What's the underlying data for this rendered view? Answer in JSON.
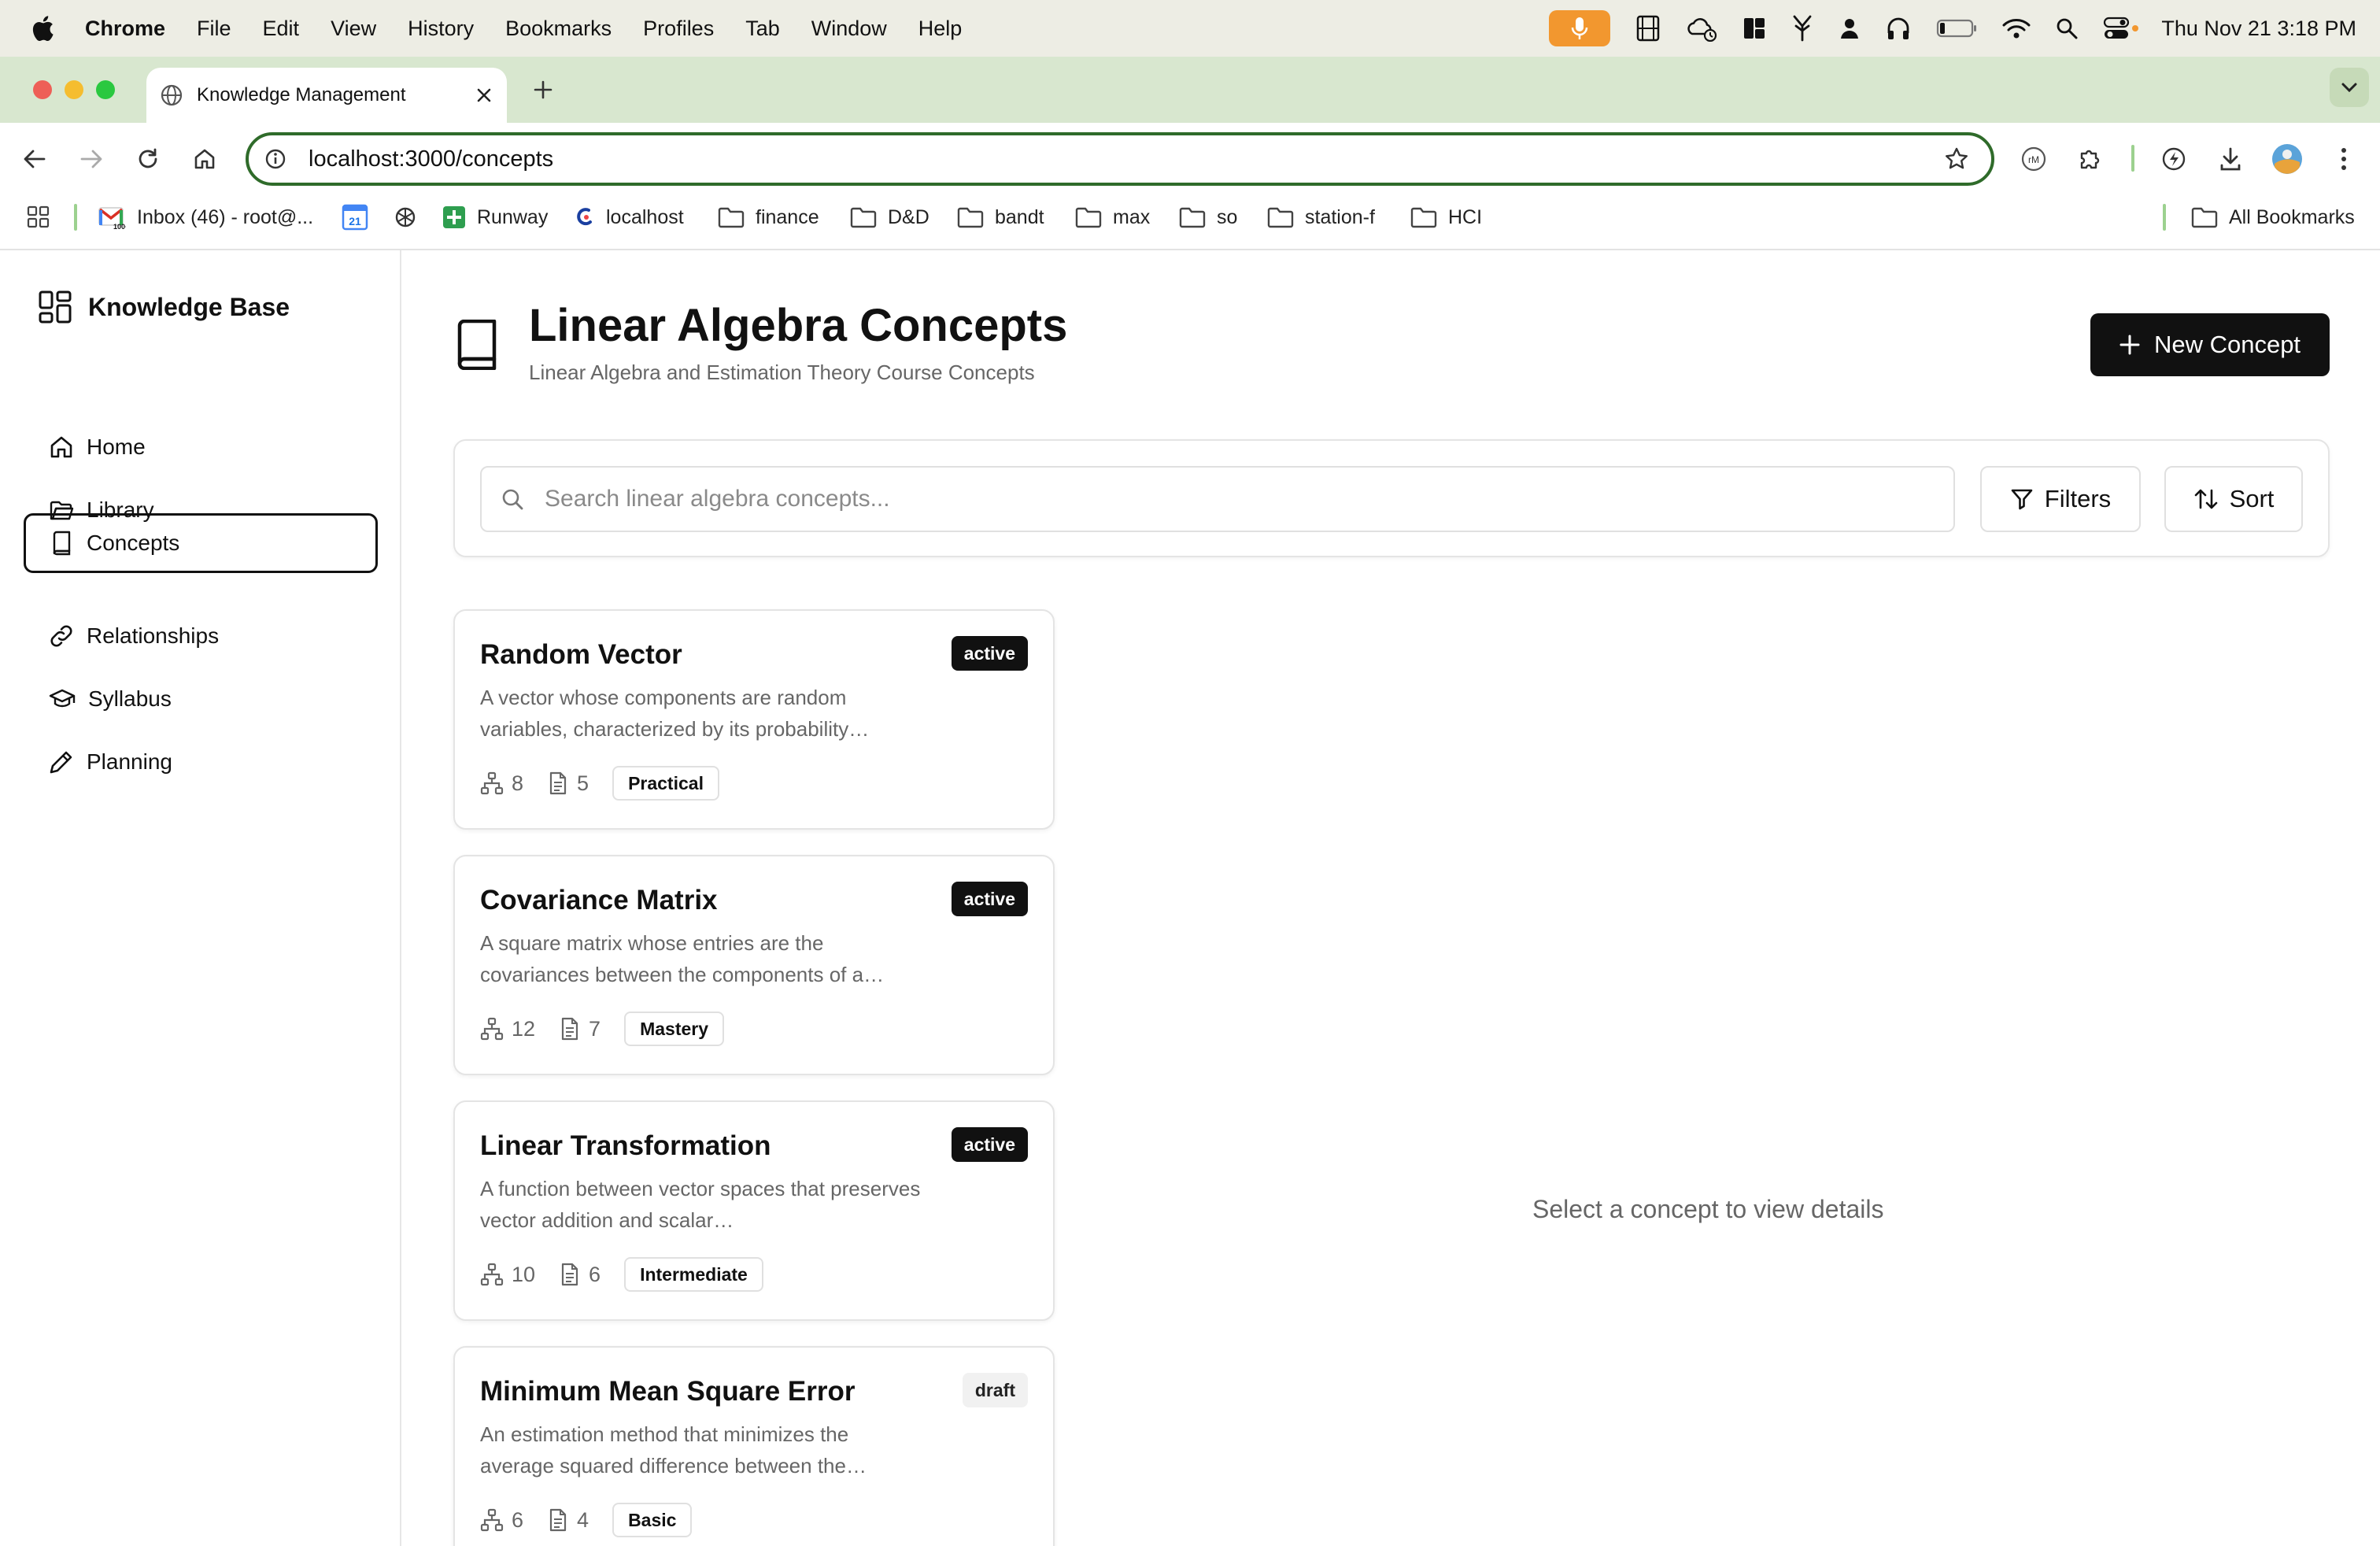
{
  "menubar": {
    "app": "Chrome",
    "items": [
      "File",
      "Edit",
      "View",
      "History",
      "Bookmarks",
      "Profiles",
      "Tab",
      "Window",
      "Help"
    ],
    "clock": "Thu Nov 21  3:18 PM"
  },
  "browser": {
    "tab_title": "Knowledge Management",
    "url": "localhost:3000/concepts",
    "bookmarks": [
      "Inbox (46) - root@...",
      "Runway",
      "localhost",
      "finance",
      "D&D",
      "bandt",
      "max",
      "so",
      "station-f",
      "HCI"
    ],
    "all_bookmarks": "All Bookmarks",
    "calendar_day": "21"
  },
  "sidebar": {
    "brand": "Knowledge Base",
    "nav": [
      {
        "label": "Home"
      },
      {
        "label": "Library"
      },
      {
        "label": "Concepts"
      },
      {
        "label": "Relationships"
      },
      {
        "label": "Syllabus"
      },
      {
        "label": "Planning"
      }
    ],
    "active": "Concepts"
  },
  "header": {
    "title": "Linear Algebra Concepts",
    "subtitle": "Linear Algebra and Estimation Theory Course Concepts",
    "new_button": "New Concept"
  },
  "search": {
    "placeholder": "Search linear algebra concepts...",
    "filters_label": "Filters",
    "sort_label": "Sort"
  },
  "concepts": [
    {
      "title": "Random Vector",
      "status": "active",
      "desc": "A vector whose components are random variables, characterized by its probability…",
      "links": "8",
      "docs": "5",
      "level": "Practical"
    },
    {
      "title": "Covariance Matrix",
      "status": "active",
      "desc": "A square matrix whose entries are the covariances between the components of a…",
      "links": "12",
      "docs": "7",
      "level": "Mastery"
    },
    {
      "title": "Linear Transformation",
      "status": "active",
      "desc": "A function between vector spaces that preserves vector addition and scalar…",
      "links": "10",
      "docs": "6",
      "level": "Intermediate"
    },
    {
      "title": "Minimum Mean Square Error",
      "status": "draft",
      "desc": "An estimation method that minimizes the average squared difference between the…",
      "links": "6",
      "docs": "4",
      "level": "Basic"
    }
  ],
  "detail": {
    "empty_text": "Select a concept to view details"
  }
}
